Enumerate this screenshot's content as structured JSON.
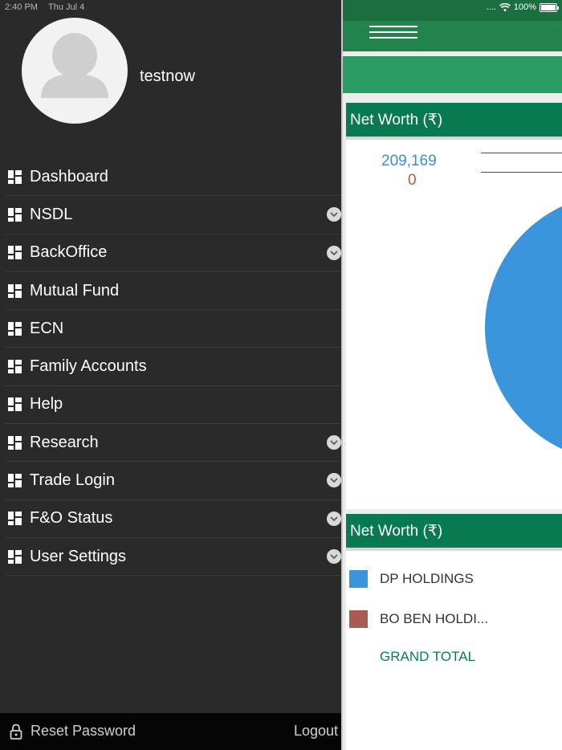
{
  "status_bar": {
    "time": "2:40 PM",
    "date": "Thu Jul 4",
    "signal": "....",
    "battery": "100%",
    "battery_level": 1.0
  },
  "drawer": {
    "username": "testnow",
    "menu": [
      {
        "label": "Dashboard",
        "expandable": false
      },
      {
        "label": "NSDL",
        "expandable": true
      },
      {
        "label": "BackOffice",
        "expandable": true
      },
      {
        "label": "Mutual Fund",
        "expandable": false
      },
      {
        "label": "ECN",
        "expandable": false
      },
      {
        "label": "Family Accounts",
        "expandable": false
      },
      {
        "label": "Help",
        "expandable": false
      },
      {
        "label": "Research",
        "expandable": true
      },
      {
        "label": "Trade Login",
        "expandable": true
      },
      {
        "label": "F&O Status",
        "expandable": true
      },
      {
        "label": "User Settings",
        "expandable": true
      }
    ],
    "footer": {
      "reset_password": "Reset Password",
      "logout": "Logout"
    }
  },
  "main": {
    "card1": {
      "title": "Net Worth (₹)",
      "value_a": "209,169",
      "value_b": "0"
    },
    "card2": {
      "title": "Net Worth (₹)",
      "legend": [
        {
          "label": "DP HOLDINGS",
          "color": "#3a95dc"
        },
        {
          "label": "BO BEN HOLDI...",
          "color": "#a95a52"
        }
      ],
      "grand_total": "GRAND TOTAL"
    }
  },
  "colors": {
    "drawer_bg": "#2a2a2a",
    "header_green": "#077a52",
    "accent_green": "#2a9b63",
    "pie_blue": "#3a95dc"
  }
}
